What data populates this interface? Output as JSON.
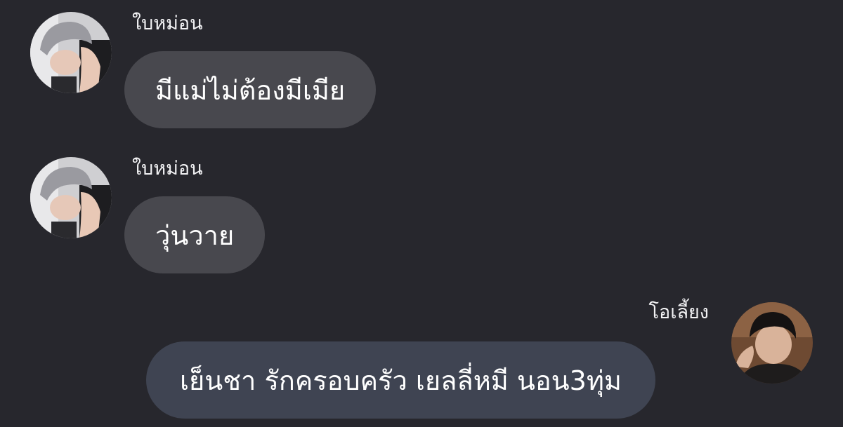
{
  "conversation": {
    "messages": [
      {
        "direction": "incoming",
        "sender": "ใบหม่อน",
        "text": "มีแม่ไม่ต้องมีเมีย"
      },
      {
        "direction": "incoming",
        "sender": "ใบหม่อน",
        "text": "วุ่นวาย"
      },
      {
        "direction": "outgoing",
        "sender": "โอเลี้ยง",
        "text": "เย็นชา รักครอบครัว เยลลี่หมี นอน3ทุ่ม"
      }
    ]
  },
  "colors": {
    "background": "#27272d",
    "incoming_bubble": "#48484e",
    "outgoing_bubble": "#3f4452",
    "text": "#ffffff"
  }
}
